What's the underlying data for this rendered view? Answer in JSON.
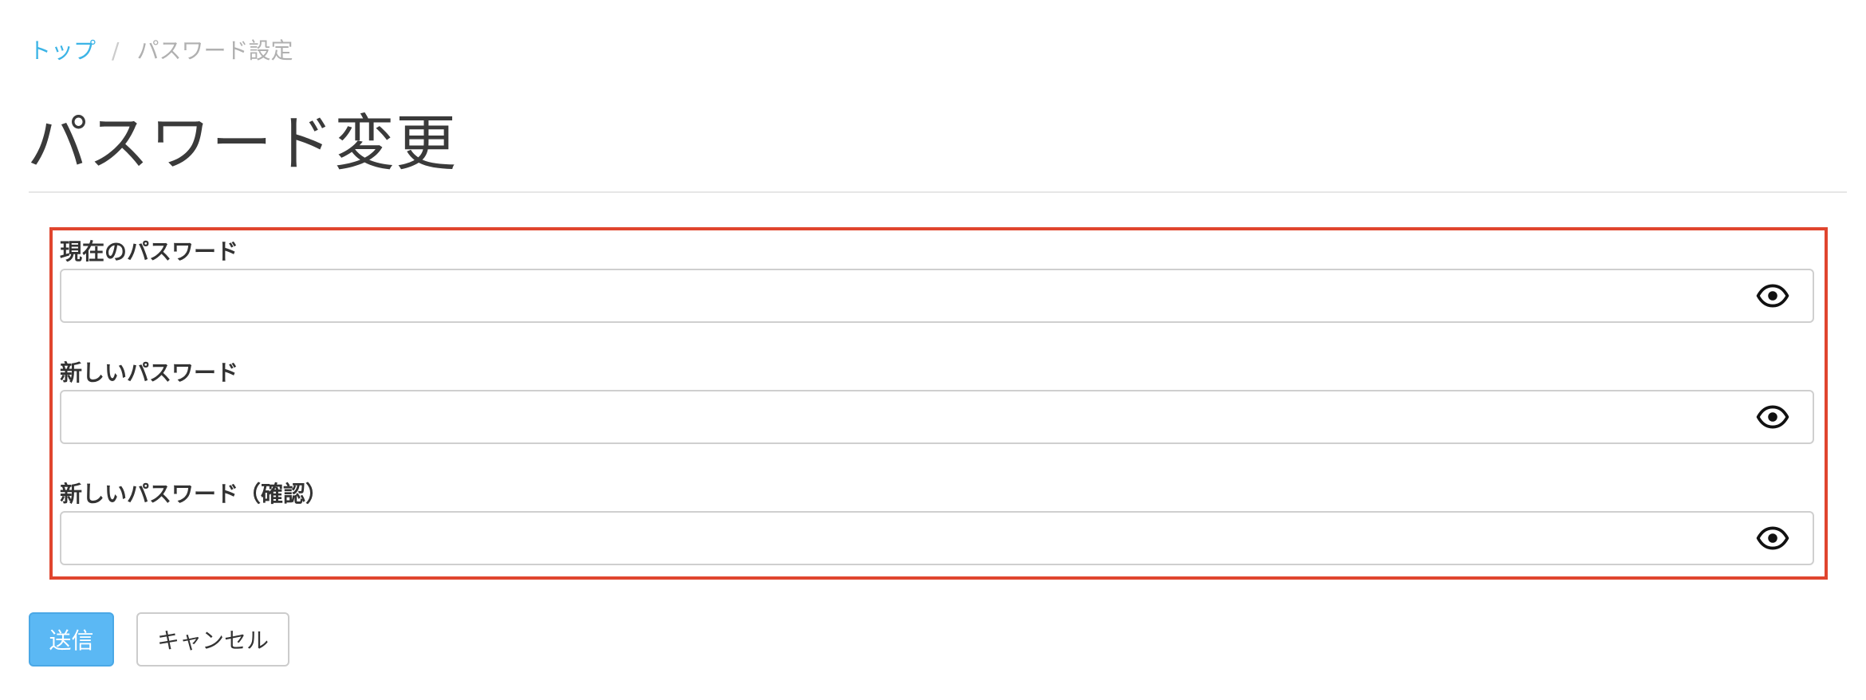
{
  "breadcrumb": {
    "home_label": "トップ",
    "separator": "/",
    "current_label": "パスワード設定"
  },
  "page": {
    "title": "パスワード変更"
  },
  "form": {
    "fields": [
      {
        "label": "現在のパスワード",
        "value": "",
        "toggle_icon": "eye-icon"
      },
      {
        "label": "新しいパスワード",
        "value": "",
        "toggle_icon": "eye-icon"
      },
      {
        "label": "新しいパスワード（確認）",
        "value": "",
        "toggle_icon": "eye-icon"
      }
    ],
    "submit_label": "送信",
    "cancel_label": "キャンセル"
  },
  "colors": {
    "link": "#3cb4e6",
    "primary_button": "#5bb8f4",
    "highlight_border": "#e0452e",
    "text": "#333333"
  }
}
